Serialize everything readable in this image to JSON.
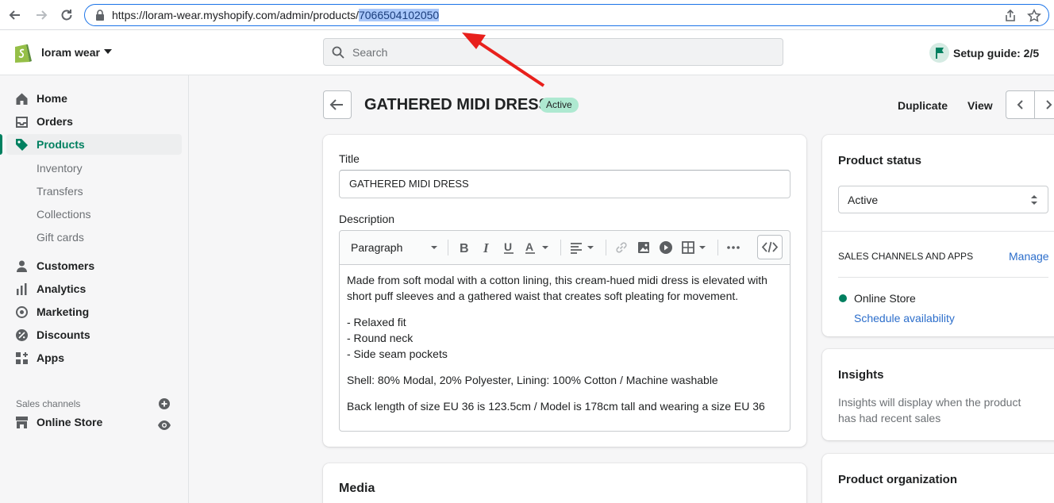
{
  "browser": {
    "url_base": "https://loram-wear.myshopify.com/admin/products/",
    "url_selected": "7066504102050"
  },
  "topbar": {
    "store_name": "loram wear",
    "search_placeholder": "Search",
    "setup_guide": "Setup guide: 2/5"
  },
  "sidebar": {
    "items": [
      {
        "label": "Home",
        "icon": "home-icon"
      },
      {
        "label": "Orders",
        "icon": "orders-icon"
      },
      {
        "label": "Products",
        "icon": "tag-icon"
      },
      {
        "label": "Customers",
        "icon": "person-icon"
      },
      {
        "label": "Analytics",
        "icon": "bar-chart-icon"
      },
      {
        "label": "Marketing",
        "icon": "target-icon"
      },
      {
        "label": "Discounts",
        "icon": "discount-icon"
      },
      {
        "label": "Apps",
        "icon": "apps-icon"
      }
    ],
    "sub_items": [
      "Inventory",
      "Transfers",
      "Collections",
      "Gift cards"
    ],
    "sales_channels_heading": "Sales channels",
    "online_store": "Online Store"
  },
  "page": {
    "title": "GATHERED MIDI DRESS",
    "status_badge": "Active",
    "duplicate": "Duplicate",
    "view": "View"
  },
  "product": {
    "title_label": "Title",
    "title_value": "GATHERED MIDI DRESS",
    "description_label": "Description",
    "toolbar_format": "Paragraph",
    "description": {
      "p1": "Made from soft modal with a cotton lining, this cream-hued midi dress is elevated with short puff sleeves and a gathered waist that creates soft pleating for movement.",
      "bullets": [
        "- Relaxed fit",
        "- Round neck",
        "- Side seam pockets"
      ],
      "p3": "Shell: 80% Modal, 20% Polyester, Lining: 100% Cotton / Machine washable",
      "p4": "Back length of size EU 36 is 123.5cm / Model is 178cm tall and wearing a size EU 36"
    },
    "media_heading": "Media"
  },
  "status_card": {
    "heading": "Product status",
    "selected": "Active",
    "channels_heading": "SALES CHANNELS AND APPS",
    "manage": "Manage",
    "channel": "Online Store",
    "schedule": "Schedule availability"
  },
  "insights": {
    "heading": "Insights",
    "text": "Insights will display when the product has had recent sales"
  },
  "organization": {
    "heading": "Product organization"
  },
  "colors": {
    "accent": "#008060",
    "badge": "#aee9d1",
    "link": "#2c6ecb",
    "annotation_arrow": "#e8201c"
  }
}
